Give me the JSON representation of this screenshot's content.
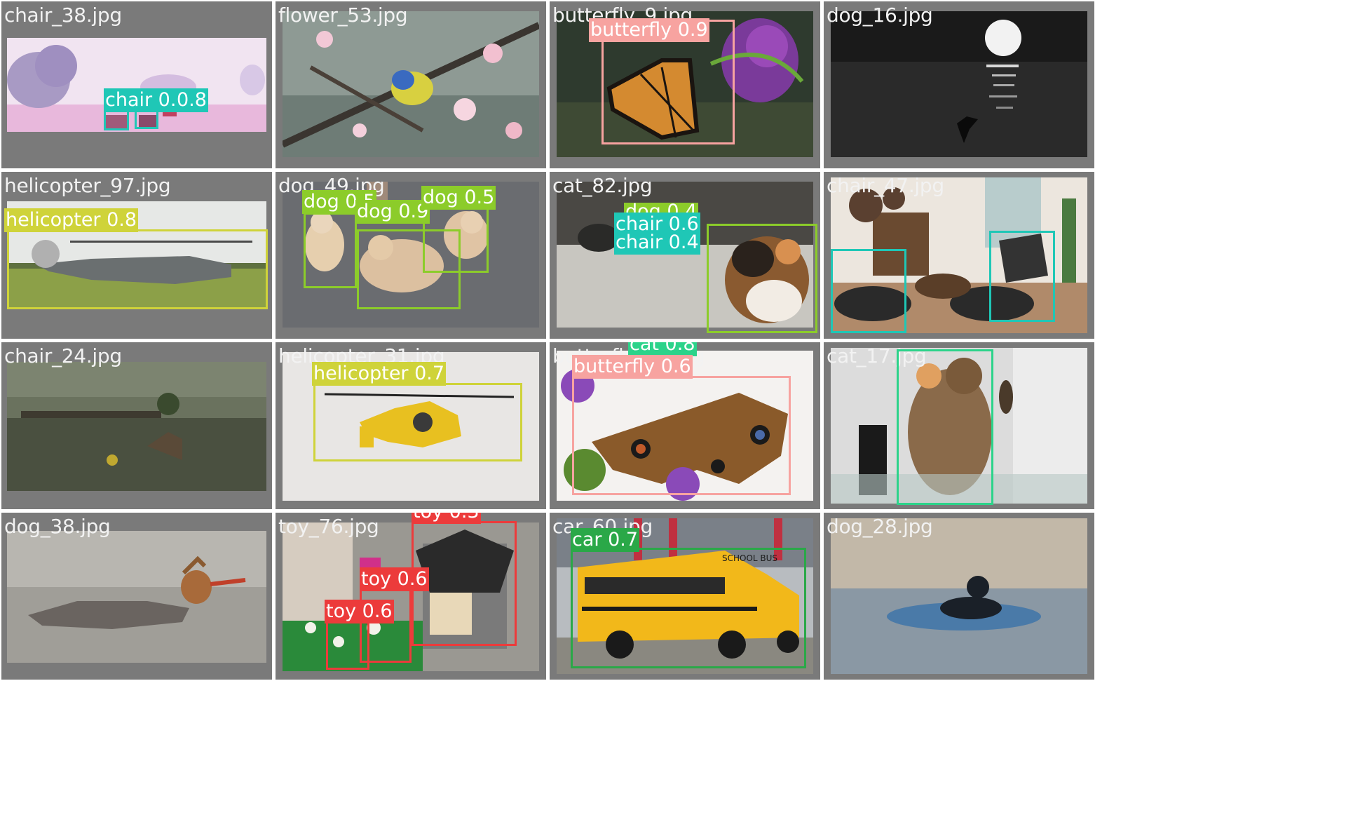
{
  "colors": {
    "background": "#ffffff",
    "tile": "#7a7a7a",
    "classes": {
      "chair": "#1fc7b6",
      "dog": "#8ccc2a",
      "helicopter": "#cfd33a",
      "butterfly": "#f7a3a0",
      "cat": "#2cd38a",
      "toy": "#ec3b3b",
      "car": "#2aa848"
    }
  },
  "tiles": [
    {
      "filename": "chair_38.jpg",
      "scene": "pink-palm-beach",
      "labels": [
        {
          "text": "chair 0.7",
          "cls": "chair"
        },
        {
          "text": "0.8",
          "cls": "chair"
        }
      ]
    },
    {
      "filename": "flower_53.jpg",
      "scene": "bluetit-blossom",
      "labels": []
    },
    {
      "filename": "butterfly_9.jpg",
      "scene": "monarch-butterfly",
      "labels": [
        {
          "text": "butterfly 0.9",
          "cls": "butterfly"
        }
      ]
    },
    {
      "filename": "dog_16.jpg",
      "scene": "night-moon-sea",
      "labels": []
    },
    {
      "filename": "helicopter_97.jpg",
      "scene": "grey-helicopter",
      "labels": [
        {
          "text": "helicopter 0.8",
          "cls": "helicopter"
        }
      ]
    },
    {
      "filename": "dog_49.jpg",
      "scene": "french-bulldogs",
      "labels": [
        {
          "text": "dog 0.5",
          "cls": "dog"
        },
        {
          "text": "dog 0.9",
          "cls": "dog"
        },
        {
          "text": "dog 0.5",
          "cls": "dog"
        }
      ]
    },
    {
      "filename": "cat_82.jpg",
      "scene": "calico-cat",
      "labels": [
        {
          "text": "dog 0.4",
          "cls": "dog"
        },
        {
          "text": "chair 0.6",
          "cls": "chair"
        },
        {
          "text": "chair 0.4",
          "cls": "chair"
        }
      ]
    },
    {
      "filename": "chair_47.jpg",
      "scene": "boho-interior",
      "labels": []
    },
    {
      "filename": "chair_24.jpg",
      "scene": "game-swamp",
      "labels": []
    },
    {
      "filename": "helicopter_31.jpg",
      "scene": "yellow-helicopter",
      "labels": [
        {
          "text": "helicopter 0.7",
          "cls": "helicopter"
        }
      ]
    },
    {
      "filename": "butterfly_17.jpg",
      "scene": "buckeye-butterfly",
      "labels": [
        {
          "text": "cat 0.8",
          "cls": "cat"
        },
        {
          "text": "butterfly 0.6",
          "cls": "butterfly"
        }
      ]
    },
    {
      "filename": "cat_17.jpg",
      "scene": "tabby-cat-bathroom",
      "labels": []
    },
    {
      "filename": "dog_38.jpg",
      "scene": "merganser-duck",
      "labels": []
    },
    {
      "filename": "toy_76.jpg",
      "scene": "lego-house",
      "labels": [
        {
          "text": "toy 0.3",
          "cls": "toy"
        },
        {
          "text": "toy 0.6",
          "cls": "toy"
        },
        {
          "text": "toy 0.6",
          "cls": "toy"
        }
      ]
    },
    {
      "filename": "car_60.jpg",
      "scene": "school-bus",
      "labels": [
        {
          "text": "car 0.7",
          "cls": "car"
        }
      ],
      "bus_text": "SCHOOL BUS"
    },
    {
      "filename": "dog_28.jpg",
      "scene": "grebe-water",
      "labels": []
    }
  ]
}
